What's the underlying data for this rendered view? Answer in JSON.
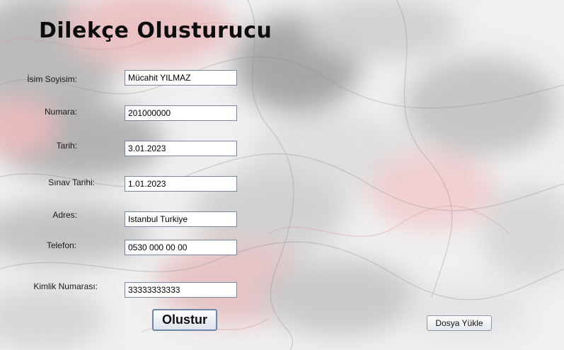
{
  "app": {
    "title": "Dilekçe Olusturucu"
  },
  "form": {
    "fields": [
      {
        "label": "İsim Soyisim:",
        "value": "Mücahit YILMAZ"
      },
      {
        "label": "Numara:",
        "value": "201000000"
      },
      {
        "label": "Tarih:",
        "value": "3.01.2023"
      },
      {
        "label": "Sınav Tarihi:",
        "value": "1.01.2023"
      },
      {
        "label": "Adres:",
        "value": "Istanbul Turkiye"
      },
      {
        "label": "Telefon:",
        "value": "0530 000 00 00"
      },
      {
        "label": "Kimlik Numarası:",
        "value": "33333333333"
      }
    ]
  },
  "buttons": {
    "create_label": "Olustur",
    "upload_label": "Dosya Yükle"
  },
  "colors": {
    "background": "#efefef",
    "swirl_gray": "#9a9a9a",
    "swirl_pink": "#e7aeb2"
  }
}
